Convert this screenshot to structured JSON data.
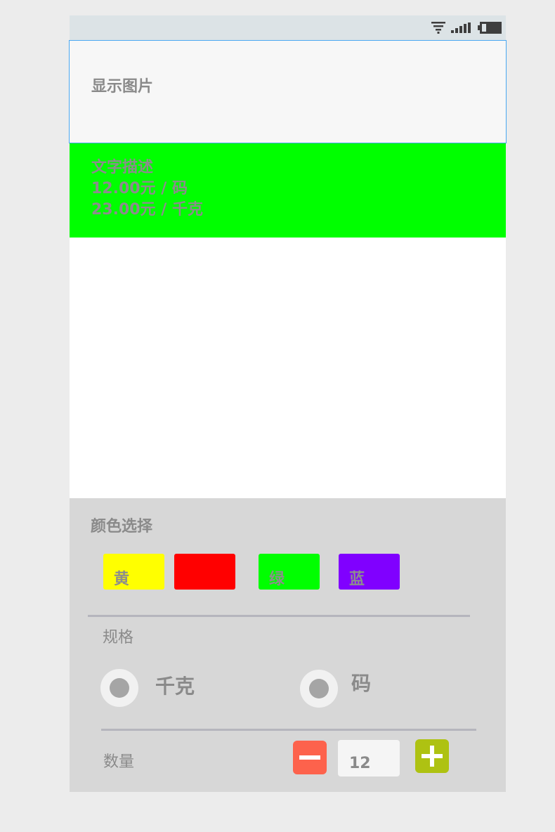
{
  "status_bar": {
    "icons": [
      "wifi-icon",
      "signal-icon",
      "battery-icon"
    ]
  },
  "image_area": {
    "label": "显示图片"
  },
  "description": {
    "background": "#00ff00",
    "lines": [
      "文字描述",
      "12.00元 / 码",
      "23.00元 / 千克"
    ]
  },
  "color_select": {
    "title": "颜色选择",
    "swatches": [
      {
        "label": "黄",
        "color": "#ffff00"
      },
      {
        "label": "",
        "color": "#ff0000"
      },
      {
        "label": "绿",
        "color": "#00ff00"
      },
      {
        "label": "蓝",
        "color": "#8000ff"
      }
    ]
  },
  "spec": {
    "title": "规格",
    "options": [
      {
        "label": "千克"
      },
      {
        "label": "码"
      }
    ]
  },
  "quantity": {
    "title": "数量",
    "value": "12",
    "minus_color": "#fd624c",
    "plus_color": "#aec212"
  }
}
